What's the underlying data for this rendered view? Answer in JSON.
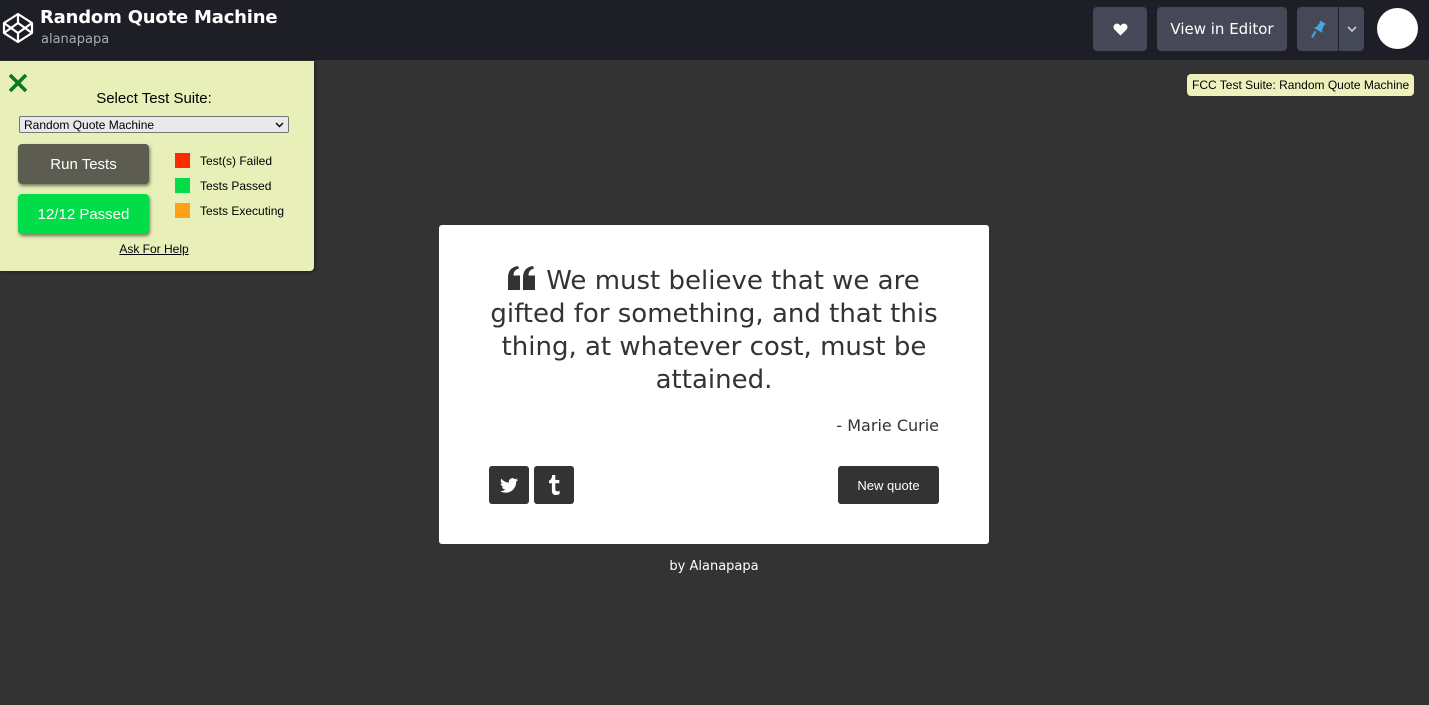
{
  "topbar": {
    "title": "Random Quote Machine",
    "user": "alanapapa",
    "view_in_editor_label": "View in Editor",
    "icons": [
      "codepen-logo-icon",
      "heart-icon",
      "pin-icon",
      "chevron-down-icon"
    ],
    "background": "#1e1f26",
    "pin_color": "#47cf73"
  },
  "fcc": {
    "select_label": "Select Test Suite:",
    "selected_suite": "Random Quote Machine",
    "run_label": "Run Tests",
    "passed_label": "12/12 Passed",
    "legend": [
      {
        "label": "Test(s) Failed",
        "color": "#ff2a00"
      },
      {
        "label": "Tests Passed",
        "color": "#00dd48"
      },
      {
        "label": "Tests Executing",
        "color": "#ff9f1a"
      }
    ],
    "help_label": "Ask For Help",
    "tooltip": "FCC Test Suite: Random Quote Machine",
    "panel_color": "#e8efb8"
  },
  "quote": {
    "text": "We must believe that we are gifted for something, and that this thing, at whatever cost, must be attained.",
    "author": "- Marie Curie",
    "new_quote_label": "New quote",
    "icons": [
      "quote-left-icon",
      "twitter-icon",
      "tumblr-icon"
    ]
  },
  "footer": {
    "by": "by",
    "name": "Alanapapa"
  }
}
